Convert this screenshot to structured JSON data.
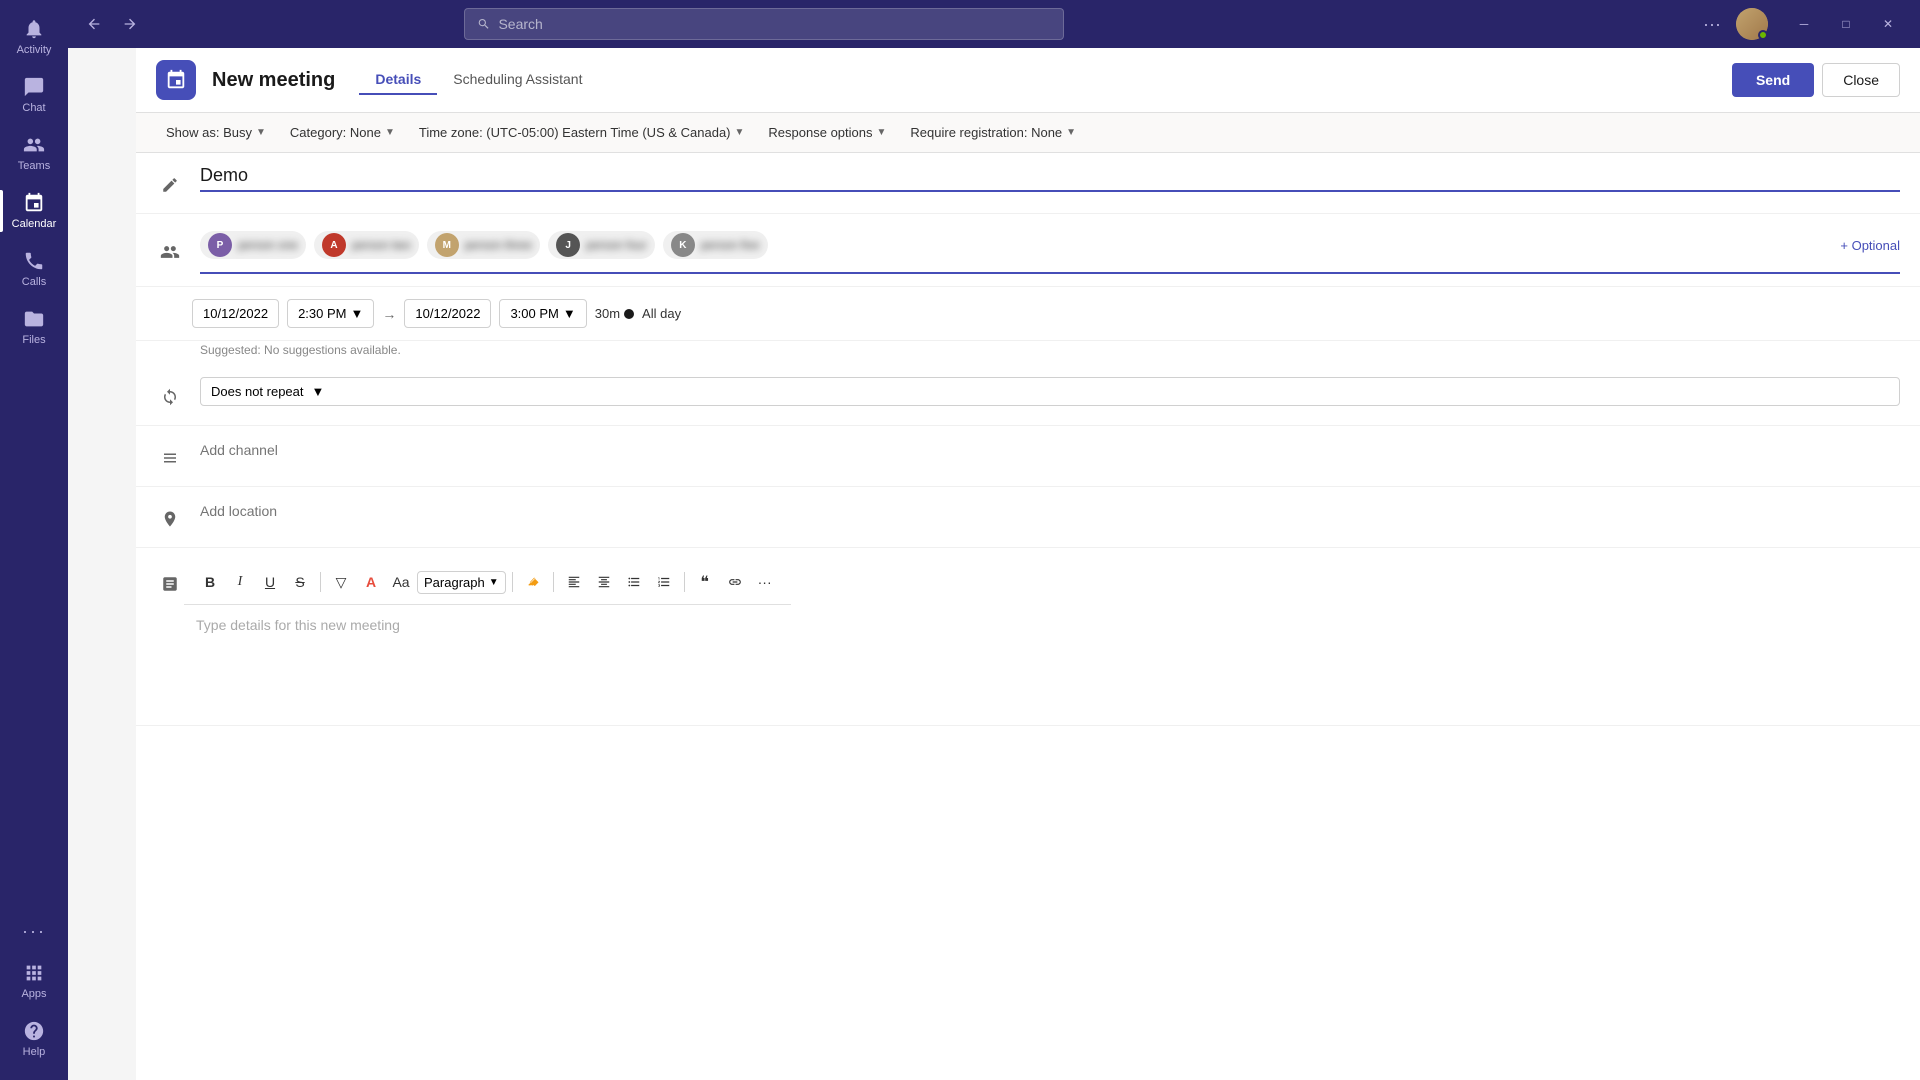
{
  "sidebar": {
    "items": [
      {
        "id": "activity",
        "label": "Activity",
        "icon": "bell"
      },
      {
        "id": "chat",
        "label": "Chat",
        "icon": "chat"
      },
      {
        "id": "teams",
        "label": "Teams",
        "icon": "teams"
      },
      {
        "id": "calendar",
        "label": "Calendar",
        "icon": "calendar",
        "active": true
      },
      {
        "id": "calls",
        "label": "Calls",
        "icon": "calls"
      },
      {
        "id": "files",
        "label": "Files",
        "icon": "files"
      }
    ],
    "bottom_items": [
      {
        "id": "more",
        "label": "···",
        "icon": "more"
      },
      {
        "id": "apps",
        "label": "Apps",
        "icon": "apps"
      },
      {
        "id": "help",
        "label": "Help",
        "icon": "help"
      }
    ]
  },
  "topbar": {
    "search_placeholder": "Search",
    "more_label": "···"
  },
  "meeting": {
    "icon": "📅",
    "title": "New meeting",
    "tabs": [
      {
        "id": "details",
        "label": "Details",
        "active": true
      },
      {
        "id": "scheduling",
        "label": "Scheduling Assistant",
        "active": false
      }
    ],
    "send_label": "Send",
    "close_label": "Close"
  },
  "options_bar": {
    "show_as": "Show as: Busy",
    "category": "Category: None",
    "timezone": "Time zone: (UTC-05:00) Eastern Time (US & Canada)",
    "response_options": "Response options",
    "require_registration": "Require registration: None"
  },
  "form": {
    "title_placeholder": "Demo",
    "title_value": "Demo",
    "attendees": [
      {
        "id": 1,
        "color": "#7B5EA7",
        "initials": "P"
      },
      {
        "id": 2,
        "color": "#d44000",
        "initials": "A"
      },
      {
        "id": 3,
        "color": "#c2a36e",
        "initials": "M"
      },
      {
        "id": 4,
        "color": "#555",
        "initials": "J"
      },
      {
        "id": 5,
        "color": "#888",
        "initials": "K"
      }
    ],
    "optional_label": "+ Optional",
    "start_date": "10/12/2022",
    "start_time": "2:30 PM",
    "end_date": "10/12/2022",
    "end_time": "3:00 PM",
    "duration": "30m",
    "allday_label": "All day",
    "suggestions_text": "Suggested: No suggestions available.",
    "repeat_label": "Does not repeat",
    "channel_placeholder": "Add channel",
    "location_placeholder": "Add location",
    "editor_placeholder": "Type details for this new meeting"
  },
  "toolbar": {
    "paragraph_label": "Paragraph",
    "buttons": [
      "B",
      "I",
      "U",
      "S",
      "▽",
      "A",
      "Aa",
      "Aα",
      "←→",
      "→←",
      "≡",
      "⋮≡",
      "❝❝",
      "🔗",
      "≡",
      "···"
    ]
  }
}
